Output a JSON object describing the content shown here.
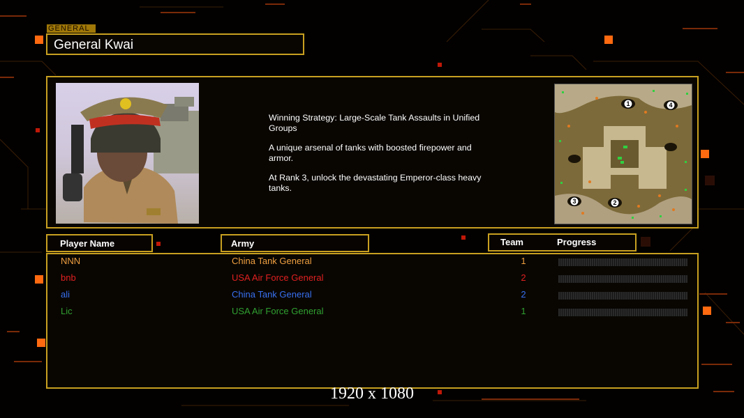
{
  "colors": {
    "accent": "#c8a020",
    "nnn": "#f0a040",
    "bnb": "#e02020",
    "ali": "#3870f0",
    "lic": "#30a030"
  },
  "header": {
    "tag": "GENERAL",
    "name": "General Kwai"
  },
  "strategy": [
    "Winning Strategy: Large-Scale Tank Assaults in Unified\n Groups",
    "A unique arsenal of tanks with boosted firepower and\n armor.",
    "At Rank 3, unlock the devastating Emperor-class heavy\n tanks."
  ],
  "columns": {
    "player": "Player Name",
    "army": "Army",
    "team": "Team",
    "progress": "Progress"
  },
  "players": [
    {
      "name": "NNN",
      "army": "China Tank General",
      "team": "1",
      "color": "#f0a040"
    },
    {
      "name": "bnb",
      "army": "USA Air Force General",
      "team": "2",
      "color": "#e02020"
    },
    {
      "name": "ali",
      "army": "China Tank General",
      "team": "2",
      "color": "#3870f0"
    },
    {
      "name": "Lic",
      "army": "USA Air Force General",
      "team": "1",
      "color": "#30a030"
    }
  ],
  "minimap": {
    "starts": [
      "1",
      "4",
      "3",
      "2"
    ]
  },
  "resolution": "1920 x 1080"
}
